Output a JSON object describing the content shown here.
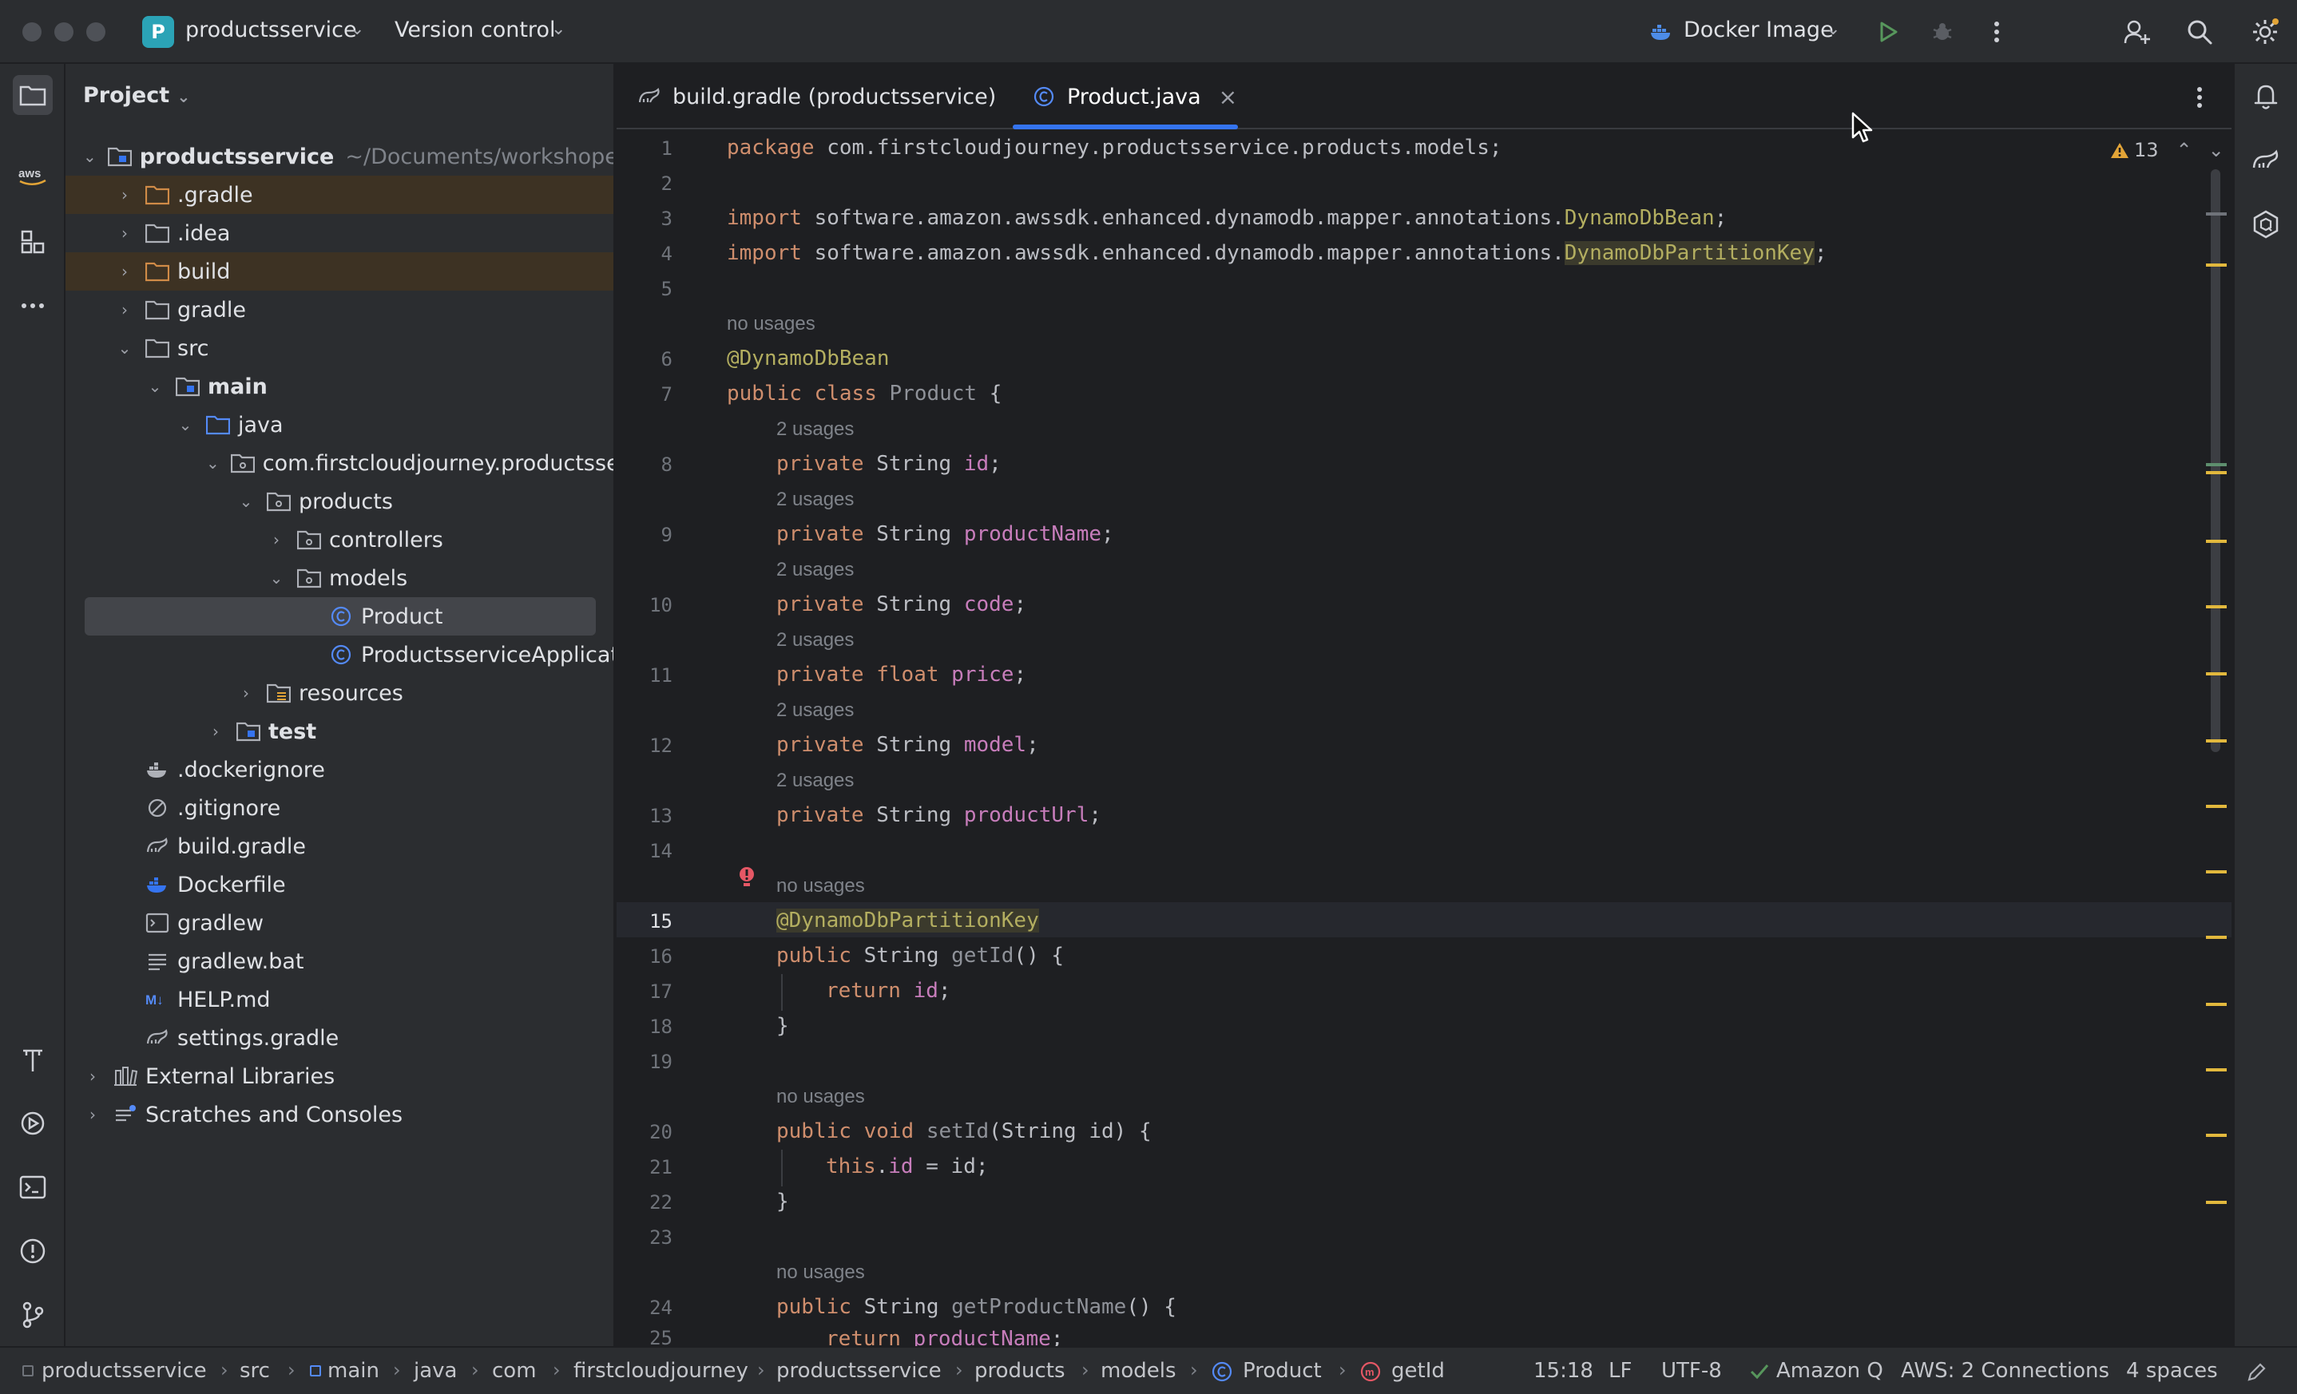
{
  "titlebar": {
    "project_badge": "P",
    "project_name": "productsservice",
    "vcs": "Version control",
    "run_config": "Docker Image"
  },
  "project_panel": {
    "title": "Project",
    "root_name": "productsservice",
    "root_path": "~/Documents/workshope/proc",
    "items": [
      ".gradle",
      ".idea",
      "build",
      "gradle",
      "src",
      "main",
      "java",
      "com.firstcloudjourney.productsserv",
      "products",
      "controllers",
      "models",
      "Product",
      "ProductsserviceApplication",
      "resources",
      "test",
      ".dockerignore",
      ".gitignore",
      "build.gradle",
      "Dockerfile",
      "gradlew",
      "gradlew.bat",
      "HELP.md",
      "settings.gradle",
      "External Libraries",
      "Scratches and Consoles"
    ]
  },
  "tabs": {
    "build": "build.gradle (productsservice)",
    "product": "Product.java",
    "close": "×"
  },
  "editor": {
    "warnings": "13",
    "line_numbers": [
      "1",
      "2",
      "3",
      "4",
      "5",
      "6",
      "7",
      "8",
      "9",
      "10",
      "11",
      "12",
      "13",
      "14",
      "15",
      "16",
      "17",
      "18",
      "19",
      "20",
      "21",
      "22",
      "23",
      "24",
      "25"
    ],
    "hints": {
      "no_usages": "no usages",
      "two_usages": "2 usages"
    },
    "code": {
      "l1_kw": "package",
      "l1": " com.firstcloudjourney.productsservice.products.models;",
      "l3_kw": "import",
      "l3": " software.amazon.awssdk.enhanced.dynamodb.mapper.annotations.",
      "l3_cls": "DynamoDbBean",
      "l4_kw": "import",
      "l4": " software.amazon.awssdk.enhanced.dynamodb.mapper.annotations.",
      "l4_cls": "DynamoDbPartitionKey",
      "semi": ";",
      "l6": "@DynamoDbBean",
      "public": "public",
      "private": "private",
      "class": "class",
      "void": "void",
      "return": "return",
      "this": "this",
      "l7_name": "Product",
      "brace_open": " {",
      "brace_close": "}",
      "string": "String",
      "float": "float",
      "f_id": "id",
      "f_productName": "productName",
      "f_code": "code",
      "f_price": "price",
      "f_model": "model",
      "f_productUrl": "productUrl",
      "l15": "@DynamoDbPartitionKey",
      "m_getId": "getId",
      "m_setId": "setId",
      "m_getProductName": "getProductName",
      "parens": "()",
      "setid_args": "(String id)",
      "assign": " = id;",
      "dot": "."
    }
  },
  "statusbar": {
    "crumbs": [
      "productsservice",
      "src",
      "main",
      "java",
      "com",
      "firstcloudjourney",
      "productsservice",
      "products",
      "models",
      "Product",
      "getId"
    ],
    "position": "15:18",
    "line_sep": "LF",
    "encoding": "UTF-8",
    "amazon_q": "Amazon Q",
    "aws": "AWS: 2 Connections",
    "indent": "4 spaces"
  }
}
